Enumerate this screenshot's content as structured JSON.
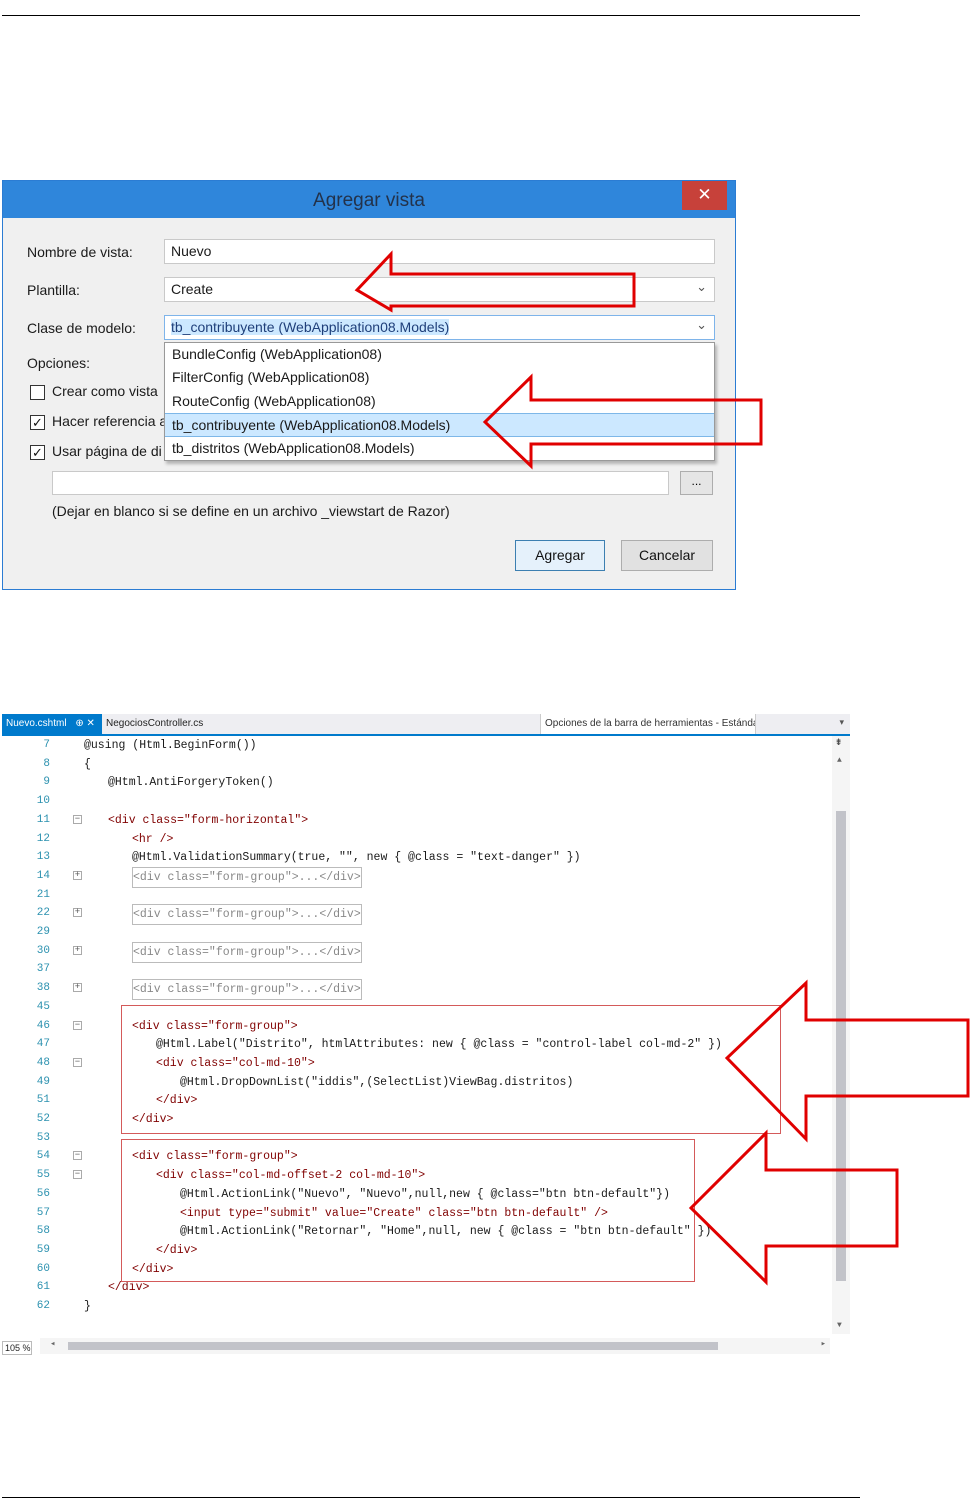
{
  "dialog": {
    "title": "Agregar vista",
    "close_glyph": "✕",
    "labels": {
      "view_name": "Nombre de vista:",
      "template": "Plantilla:",
      "model_class": "Clase de modelo:",
      "options": "Opciones:"
    },
    "view_name_value": "Nuevo",
    "template_value": "Create",
    "model_class_value": "tb_contribuyente (WebApplication08.Models)",
    "dropdown_options": [
      "BundleConfig (WebApplication08)",
      "FilterConfig (WebApplication08)",
      "RouteConfig (WebApplication08)",
      "tb_contribuyente (WebApplication08.Models)",
      "tb_distritos (WebApplication08.Models)"
    ],
    "dropdown_selected_index": 3,
    "checkboxes": [
      {
        "label": "Crear como vista",
        "checked": false
      },
      {
        "label": "Hacer referencia a",
        "checked": true
      },
      {
        "label": "Usar página de di",
        "checked": true
      }
    ],
    "layout_path_value": "",
    "browse_label": "...",
    "hint_text": "(Dejar en blanco si se define en un archivo _viewstart de Razor)",
    "buttons": {
      "add": "Agregar",
      "cancel": "Cancelar"
    }
  },
  "editor": {
    "active_tab": "Nuevo.cshtml",
    "active_tab_icons": "⊕ ✕",
    "inactive_tab": "NegociosController.cs",
    "nav_combo": "Opciones de la barra de herramientas - Estándar",
    "zoom": "105 %",
    "lines": [
      {
        "n": "7",
        "fold": "",
        "indent": 0,
        "code": "@using (Html.BeginForm())"
      },
      {
        "n": "8",
        "fold": "",
        "indent": 0,
        "code": "{"
      },
      {
        "n": "9",
        "fold": "",
        "indent": 1,
        "code": "@Html.AntiForgeryToken()"
      },
      {
        "n": "10",
        "fold": "",
        "indent": 0,
        "code": ""
      },
      {
        "n": "11",
        "fold": "−",
        "indent": 1,
        "code": "<div class=\"form-horizontal\">"
      },
      {
        "n": "12",
        "fold": "",
        "indent": 2,
        "code": "<hr />"
      },
      {
        "n": "13",
        "fold": "",
        "indent": 2,
        "code": "@Html.ValidationSummary(true, \"\", new { @class = \"text-danger\" })"
      },
      {
        "n": "14",
        "fold": "+",
        "indent": 2,
        "code": "<div class=\"form-group\">...</div>"
      },
      {
        "n": "21",
        "fold": "",
        "indent": 0,
        "code": ""
      },
      {
        "n": "22",
        "fold": "+",
        "indent": 2,
        "code": "<div class=\"form-group\">...</div>"
      },
      {
        "n": "29",
        "fold": "",
        "indent": 0,
        "code": ""
      },
      {
        "n": "30",
        "fold": "+",
        "indent": 2,
        "code": "<div class=\"form-group\">...</div>"
      },
      {
        "n": "37",
        "fold": "",
        "indent": 0,
        "code": ""
      },
      {
        "n": "38",
        "fold": "+",
        "indent": 2,
        "code": "<div class=\"form-group\">...</div>"
      },
      {
        "n": "45",
        "fold": "",
        "indent": 0,
        "code": ""
      },
      {
        "n": "46",
        "fold": "−",
        "indent": 2,
        "code": "<div class=\"form-group\">"
      },
      {
        "n": "47",
        "fold": "",
        "indent": 3,
        "code": "@Html.Label(\"Distrito\", htmlAttributes: new { @class = \"control-label col-md-2\" })"
      },
      {
        "n": "48",
        "fold": "−",
        "indent": 3,
        "code": "<div class=\"col-md-10\">"
      },
      {
        "n": "49",
        "fold": "",
        "indent": 4,
        "code": "@Html.DropDownList(\"iddis\",(SelectList)ViewBag.distritos)"
      },
      {
        "n": "51",
        "fold": "",
        "indent": 3,
        "code": "</div>"
      },
      {
        "n": "52",
        "fold": "",
        "indent": 2,
        "code": "</div>"
      },
      {
        "n": "53",
        "fold": "",
        "indent": 0,
        "code": ""
      },
      {
        "n": "54",
        "fold": "−",
        "indent": 2,
        "code": "<div class=\"form-group\">"
      },
      {
        "n": "55",
        "fold": "−",
        "indent": 3,
        "code": "<div class=\"col-md-offset-2 col-md-10\">"
      },
      {
        "n": "56",
        "fold": "",
        "indent": 4,
        "code": "@Html.ActionLink(\"Nuevo\", \"Nuevo\",null,new { @class=\"btn btn-default\"})"
      },
      {
        "n": "57",
        "fold": "",
        "indent": 4,
        "code": "<input type=\"submit\" value=\"Create\" class=\"btn btn-default\" />"
      },
      {
        "n": "58",
        "fold": "",
        "indent": 4,
        "code": "@Html.ActionLink(\"Retornar\", \"Home\",null, new { @class = \"btn btn-default\" })"
      },
      {
        "n": "59",
        "fold": "",
        "indent": 3,
        "code": "</div>"
      },
      {
        "n": "60",
        "fold": "",
        "indent": 2,
        "code": "</div>"
      },
      {
        "n": "61",
        "fold": "",
        "indent": 1,
        "code": "</div>"
      },
      {
        "n": "62",
        "fold": "",
        "indent": 0,
        "code": "}"
      }
    ]
  },
  "colors": {
    "arrow": "#e00000",
    "titlebar": "#2f86db",
    "close": "#c7413a",
    "tab_accent": "#007acc",
    "highlight_box": "#d45a5a"
  }
}
